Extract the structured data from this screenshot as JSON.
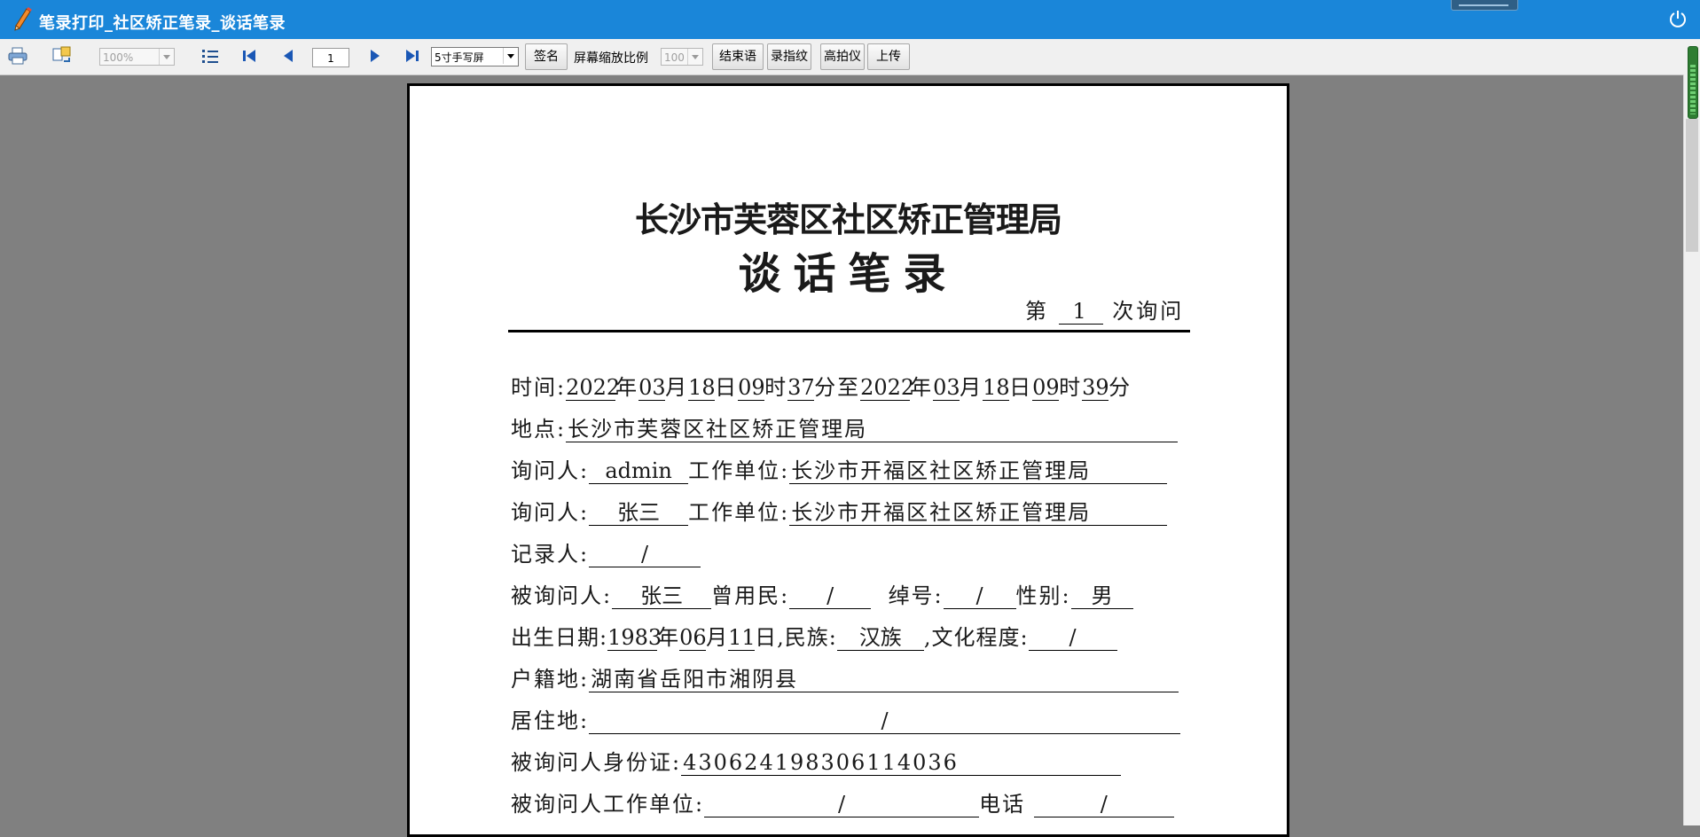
{
  "window": {
    "title": "笔录打印_社区矫正笔录_谈话笔录",
    "icons": [
      "pencil-icon",
      "power-icon"
    ]
  },
  "toolbar": {
    "zoom_value": "100%",
    "page_number": "1",
    "screen_select": "5寸手写屏",
    "sign_label": "签名",
    "screen_scale_label": "屏幕缩放比例",
    "screen_scale_value": "100",
    "end_phrase_label": "结束语",
    "fingerprint_label": "录指纹",
    "camera_label": "高拍仪",
    "upload_label": "上传"
  },
  "document": {
    "org": "长沙市芙蓉区社区矫正管理局",
    "title": "谈话笔录",
    "session_prefix": "第",
    "session_number": "1",
    "session_suffix": "次询问",
    "time_label": "时间:",
    "start_year": "2022",
    "start_month": "03",
    "start_day": "18",
    "start_hour": "09",
    "start_min": "37",
    "end_year": "2022",
    "end_month": "03",
    "end_day": "18",
    "end_hour": "09",
    "end_min": "39",
    "year_char": "年",
    "month_char": "月",
    "day_char": "日",
    "hour_char": "时",
    "min_char": "分",
    "to_char": "至",
    "location_label": "地点:",
    "location": "长沙市芙蓉区社区矫正管理局",
    "asker_label": "询问人:",
    "asker1": "admin",
    "asker2": "张三",
    "work_unit_label": "工作单位:",
    "work_unit1": "长沙市开福区社区矫正管理局",
    "work_unit2": "长沙市开福区社区矫正管理局",
    "recorder_label": "记录人:",
    "recorder": "/",
    "subject_label": "被询问人:",
    "subject": "张三",
    "former_name_label": "曾用民:",
    "former_name": "/",
    "nickname_label": "绰号:",
    "nickname": "/",
    "gender_label": "性别:",
    "gender": "男",
    "birth_label": "出生日期:",
    "birth_year": "1983",
    "birth_month": "06",
    "birth_day": "11",
    "birth_day_suffix": "日,民族:",
    "ethnicity": "汉族",
    "education_label": ",文化程度:",
    "education": "/",
    "domicile_label": "户籍地:",
    "domicile": "湖南省岳阳市湘阴县",
    "residence_label": "居住地:",
    "residence": "/",
    "id_label": "被询问人身份证:",
    "id_number": "430624198306114036",
    "subject_work_label": "被询问人工作单位:",
    "subject_work": "/",
    "phone_label": "电话",
    "phone": "/"
  }
}
